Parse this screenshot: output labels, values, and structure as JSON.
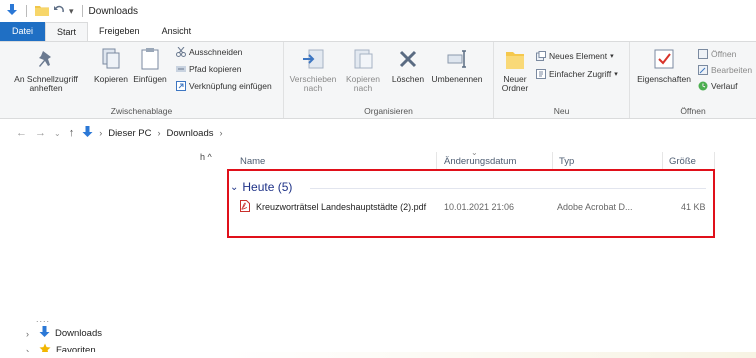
{
  "window": {
    "title": "Downloads"
  },
  "tabs": [
    "Datei",
    "Start",
    "Freigeben",
    "Ansicht"
  ],
  "ribbon": {
    "clipboard": {
      "label": "Zwischenablage",
      "pin": "An Schnellzugriff anheften",
      "copy": "Kopieren",
      "paste": "Einfügen",
      "cut": "Ausschneiden",
      "copy_path": "Pfad kopieren",
      "paste_shortcut": "Verknüpfung einfügen"
    },
    "organize": {
      "label": "Organisieren",
      "move_to": "Verschieben nach",
      "copy_to": "Kopieren nach",
      "delete": "Löschen",
      "rename": "Umbenennen"
    },
    "new": {
      "label": "Neu",
      "new_folder": "Neuer Ordner",
      "new_item": "Neues Element",
      "easy_access": "Einfacher Zugriff"
    },
    "open": {
      "label": "Öffnen",
      "properties": "Eigenschaften",
      "open": "Öffnen",
      "edit": "Bearbeiten",
      "history": "Verlauf"
    }
  },
  "address": {
    "crumbs": [
      "Dieser PC",
      "Downloads"
    ]
  },
  "nav_pane": {
    "hint": "h ^",
    "dots": "....",
    "items": [
      "Downloads",
      "Favoriten"
    ]
  },
  "columns": {
    "name": "Name",
    "date": "Änderungsdatum",
    "type": "Typ",
    "size": "Größe"
  },
  "group": {
    "label": "Heute (5)"
  },
  "files": [
    {
      "name": "Kreuzworträtsel Landeshauptstädte (2).pdf",
      "date": "10.01.2021 21:06",
      "type": "Adobe Acrobat D...",
      "size": "41 KB"
    }
  ],
  "colors": {
    "accent": "#1f6fc4",
    "highlight": "#e0101a",
    "group_header": "#1e3287"
  }
}
